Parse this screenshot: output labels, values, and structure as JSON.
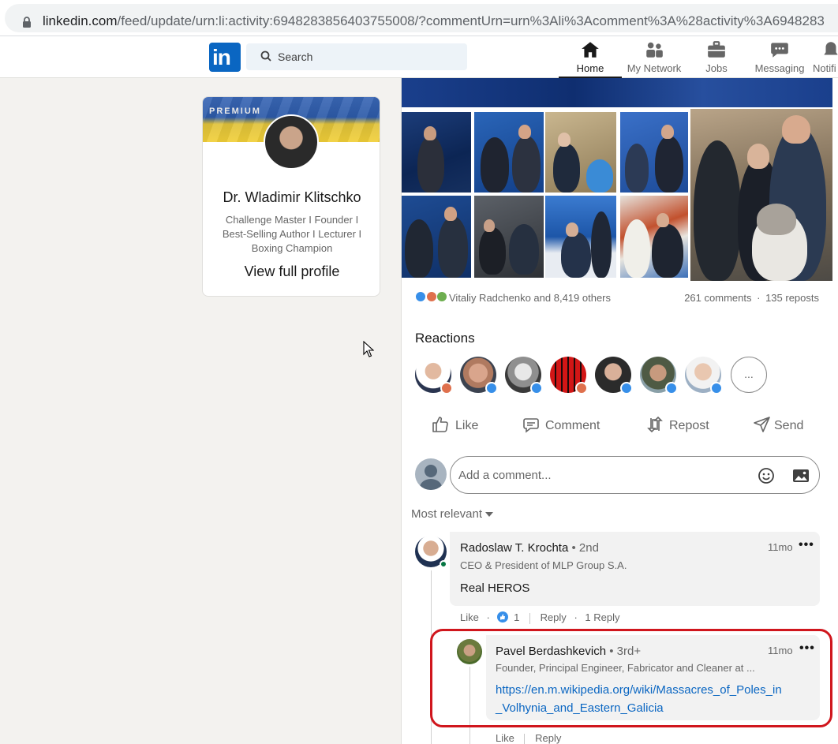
{
  "browser": {
    "url_host": "linkedin.com",
    "url_path": "/feed/update/urn:li:activity:6948283856403755008/?commentUrn=urn%3Ali%3Acomment%3A%28activity%3A6948283"
  },
  "nav": {
    "logo_text": "in",
    "search_placeholder": "Search",
    "items": [
      {
        "label": "Home",
        "icon": "home-icon"
      },
      {
        "label": "My Network",
        "icon": "network-icon"
      },
      {
        "label": "Jobs",
        "icon": "briefcase-icon"
      },
      {
        "label": "Messaging",
        "icon": "chat-icon"
      },
      {
        "label": "Notifi",
        "icon": "bell-icon"
      }
    ]
  },
  "profile_card": {
    "badge": "PREMIUM",
    "name": "Dr. Wladimir Klitschko",
    "headline": "Challenge Master I Founder I Best-Selling Author I Lecturer I Boxing Champion",
    "view_profile": "View full profile"
  },
  "post": {
    "reactions_summary": "Vitaliy Radchenko and 8,419 others",
    "comments_count": "261 comments",
    "reposts_count": "135 reposts",
    "reactions_title": "Reactions",
    "more_reactors": "...",
    "actions": {
      "like": "Like",
      "comment": "Comment",
      "repost": "Repost",
      "send": "Send"
    },
    "comment_placeholder": "Add a comment...",
    "sort_label": "Most relevant"
  },
  "comments": [
    {
      "author": "Radoslaw T. Krochta",
      "degree": "• 2nd",
      "headline": "CEO & President of MLP Group S.A.",
      "time": "11mo",
      "text": "Real HEROS",
      "like": "Like",
      "like_count": "1",
      "reply": "Reply",
      "replies": "1 Reply"
    },
    {
      "author": "Pavel Berdashkevich",
      "degree": "• 3rd+",
      "headline": "Founder, Principal Engineer, Fabricator and Cleaner at ...",
      "time": "11mo",
      "link_line1": "https://en.m.wikipedia.org/wiki/Massacres_of_Poles_in",
      "link_line2": "_Volhynia_and_Eastern_Galicia",
      "like": "Like",
      "reply": "Reply"
    }
  ],
  "colors": {
    "brand": "#0a66c2",
    "highlight": "#d0161d",
    "page_bg": "#f3f2ef"
  }
}
